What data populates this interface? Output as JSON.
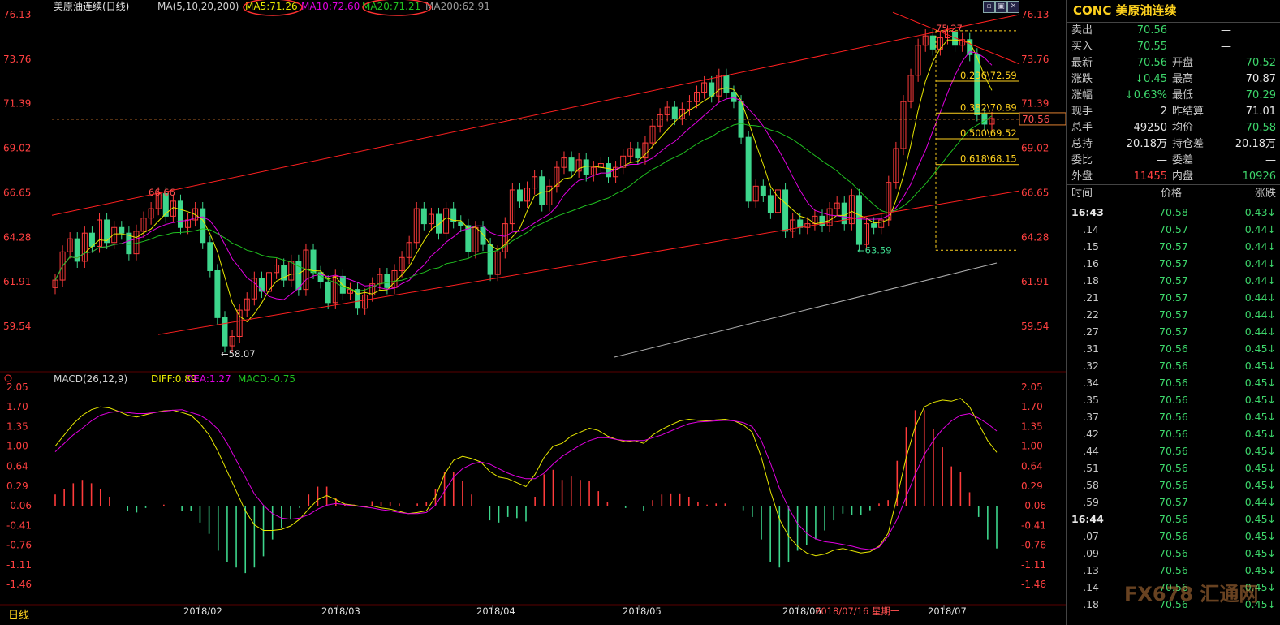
{
  "header": {
    "title": "美原油连续(日线)",
    "ma_label": "MA(5,10,20,200)",
    "ma5": "MA5:71.26",
    "ma10": "MA10:72.60",
    "ma20": "MA20:71.21",
    "ma200": "MA200:62.91"
  },
  "macd_header": {
    "label": "MACD(26,12,9)",
    "diff": "DIFF:0.89",
    "dea": "DEA:1.27",
    "macd": "MACD:-0.75"
  },
  "colors": {
    "up": "#ff3b3b",
    "down": "#3dd68c",
    "ma5": "#e8e800",
    "ma10": "#e000e0",
    "ma20": "#20c020",
    "ma200": "#b0b0b0",
    "trend": "#ff2020",
    "fib": "#ffd21e"
  },
  "chart_data": {
    "type": "candlestick",
    "price_ticks": [
      "76.13",
      "73.76",
      "71.39",
      "69.02",
      "66.65",
      "64.28",
      "61.91",
      "59.54"
    ],
    "macd_ticks": [
      "2.05",
      "1.70",
      "1.35",
      "1.00",
      "0.64",
      "0.29",
      "-0.06",
      "-0.41",
      "-0.76",
      "-1.11",
      "-1.46"
    ],
    "x_labels": [
      "2018/02",
      "2018/03",
      "2018/04",
      "2018/05",
      "2018/06",
      "2018/07"
    ],
    "cursor_label": "2018/07/16 星期一",
    "period_button": "日线",
    "last_price_tag": "70.56",
    "annotations": {
      "high": "75.27",
      "low_left": "58.07",
      "left_peak": "66.66",
      "low_right": "63.59"
    },
    "fibonacci": [
      {
        "ratio": "0.236",
        "price": "72.59"
      },
      {
        "ratio": "0.382",
        "price": "70.89"
      },
      {
        "ratio": "0.500",
        "price": "69.52"
      },
      {
        "ratio": "0.618",
        "price": "68.15"
      }
    ],
    "close": [
      62.0,
      63.5,
      64.2,
      63.0,
      64.5,
      63.8,
      65.2,
      64.0,
      64.8,
      64.5,
      63.4,
      64.6,
      65.3,
      65.8,
      66.6,
      65.4,
      66.2,
      64.8,
      65.2,
      65.8,
      64.0,
      62.5,
      60.0,
      58.5,
      59.0,
      60.4,
      61.0,
      62.1,
      61.4,
      62.4,
      62.8,
      62.0,
      63.0,
      61.5,
      63.6,
      62.4,
      61.9,
      60.8,
      62.2,
      61.3,
      61.5,
      60.5,
      61.2,
      61.8,
      62.3,
      61.6,
      62.5,
      63.2,
      64.0,
      65.8,
      65.0,
      65.5,
      64.5,
      65.8,
      65.1,
      64.9,
      63.5,
      64.8,
      63.9,
      62.3,
      63.5,
      65.0,
      66.8,
      66.2,
      66.9,
      67.5,
      66.0,
      67.0,
      68.0,
      68.5,
      67.8,
      68.4,
      67.6,
      68.0,
      68.2,
      67.5,
      68.0,
      68.6,
      69.0,
      68.5,
      69.3,
      70.2,
      70.8,
      71.2,
      70.6,
      71.1,
      71.5,
      72.0,
      72.5,
      71.8,
      72.9,
      72.0,
      71.5,
      69.6,
      66.2,
      67.0,
      66.5,
      65.6,
      66.8,
      64.6,
      65.2,
      64.8,
      65.0,
      65.4,
      64.9,
      65.8,
      66.1,
      65.0,
      66.5,
      63.9,
      65.0,
      64.8,
      65.2,
      67.2,
      69.0,
      71.5,
      72.9,
      74.5,
      75.0,
      74.3,
      74.9,
      75.2,
      74.5,
      74.8,
      74.0,
      70.8,
      70.3,
      70.6
    ],
    "ma200_end": [
      60.1,
      62.91
    ],
    "macd_series_desc": "DIFF/DEA/histogram drawn from values",
    "diff": [
      1.0,
      1.2,
      1.4,
      1.55,
      1.65,
      1.7,
      1.68,
      1.62,
      1.55,
      1.52,
      1.56,
      1.6,
      1.63,
      1.64,
      1.6,
      1.55,
      1.4,
      1.2,
      0.9,
      0.55,
      0.2,
      -0.15,
      -0.4,
      -0.5,
      -0.5,
      -0.48,
      -0.42,
      -0.3,
      -0.12,
      0.05,
      0.12,
      0.05,
      -0.03,
      -0.05,
      -0.08,
      -0.06,
      -0.1,
      -0.12,
      -0.16,
      -0.2,
      -0.18,
      -0.15,
      0.1,
      0.5,
      0.75,
      0.82,
      0.78,
      0.72,
      0.55,
      0.45,
      0.42,
      0.35,
      0.28,
      0.5,
      0.8,
      1.0,
      1.05,
      1.18,
      1.25,
      1.32,
      1.28,
      1.18,
      1.12,
      1.08,
      1.1,
      1.05,
      1.2,
      1.3,
      1.38,
      1.45,
      1.48,
      1.46,
      1.45,
      1.47,
      1.48,
      1.45,
      1.38,
      1.25,
      0.8,
      0.2,
      -0.3,
      -0.6,
      -0.78,
      -0.9,
      -0.95,
      -0.92,
      -0.85,
      -0.82,
      -0.86,
      -0.9,
      -0.88,
      -0.78,
      -0.55,
      0.1,
      0.8,
      1.35,
      1.7,
      1.78,
      1.82,
      1.8,
      1.85,
      1.7,
      1.4,
      1.1,
      0.89
    ],
    "dea": [
      0.9,
      1.05,
      1.2,
      1.32,
      1.45,
      1.55,
      1.6,
      1.62,
      1.6,
      1.58,
      1.58,
      1.6,
      1.62,
      1.64,
      1.65,
      1.6,
      1.55,
      1.45,
      1.3,
      1.05,
      0.75,
      0.45,
      0.15,
      -0.05,
      -0.2,
      -0.28,
      -0.3,
      -0.28,
      -0.22,
      -0.12,
      -0.05,
      -0.02,
      -0.04,
      -0.06,
      -0.08,
      -0.1,
      -0.13,
      -0.15,
      -0.18,
      -0.2,
      -0.2,
      -0.18,
      -0.05,
      0.2,
      0.45,
      0.6,
      0.68,
      0.72,
      0.68,
      0.6,
      0.52,
      0.46,
      0.42,
      0.42,
      0.52,
      0.68,
      0.82,
      0.92,
      1.02,
      1.1,
      1.15,
      1.15,
      1.12,
      1.1,
      1.1,
      1.1,
      1.15,
      1.2,
      1.27,
      1.34,
      1.4,
      1.43,
      1.44,
      1.45,
      1.46,
      1.45,
      1.42,
      1.35,
      1.1,
      0.7,
      0.25,
      -0.1,
      -0.38,
      -0.55,
      -0.65,
      -0.7,
      -0.72,
      -0.75,
      -0.78,
      -0.82,
      -0.84,
      -0.8,
      -0.6,
      -0.3,
      0.1,
      0.5,
      0.85,
      1.1,
      1.3,
      1.45,
      1.55,
      1.58,
      1.5,
      1.4,
      1.27
    ]
  },
  "quote_panel": {
    "title": "CONC 美原油连续",
    "rows": [
      {
        "l": "卖出",
        "v": "70.56",
        "v2": "—",
        "l2": "",
        "r": ""
      },
      {
        "l": "买入",
        "v": "70.55",
        "v2": "—",
        "l2": "",
        "r": ""
      },
      {
        "l": "最新",
        "v": "70.56",
        "l2": "开盘",
        "r": "70.52"
      },
      {
        "l": "涨跌",
        "v": "↓0.45",
        "l2": "最高",
        "r": "70.87"
      },
      {
        "l": "涨幅",
        "v": "↓0.63%",
        "l2": "最低",
        "r": "70.29"
      },
      {
        "l": "现手",
        "v": "2",
        "l2": "昨结算",
        "r": "71.01"
      },
      {
        "l": "总手",
        "v": "49250",
        "l2": "均价",
        "r": "70.58"
      },
      {
        "l": "总持",
        "v": "20.18万",
        "l2": "持仓差",
        "r": "20.18万"
      },
      {
        "l": "委比",
        "v": "—",
        "l2": "委差",
        "r": "—"
      },
      {
        "l": "外盘",
        "v": "11455",
        "l2": "内盘",
        "r": "10926"
      }
    ],
    "tick_header": {
      "time": "时间",
      "price": "价格",
      "change": "涨跌"
    },
    "ticks": [
      {
        "t": "16:43",
        "p": "70.58",
        "c": "0.43"
      },
      {
        "t": ".14",
        "p": "70.57",
        "c": "0.44"
      },
      {
        "t": ".15",
        "p": "70.57",
        "c": "0.44"
      },
      {
        "t": ".16",
        "p": "70.57",
        "c": "0.44"
      },
      {
        "t": ".18",
        "p": "70.57",
        "c": "0.44"
      },
      {
        "t": ".21",
        "p": "70.57",
        "c": "0.44"
      },
      {
        "t": ".22",
        "p": "70.57",
        "c": "0.44"
      },
      {
        "t": ".27",
        "p": "70.57",
        "c": "0.44"
      },
      {
        "t": ".31",
        "p": "70.56",
        "c": "0.45"
      },
      {
        "t": ".32",
        "p": "70.56",
        "c": "0.45"
      },
      {
        "t": ".34",
        "p": "70.56",
        "c": "0.45"
      },
      {
        "t": ".35",
        "p": "70.56",
        "c": "0.45"
      },
      {
        "t": ".37",
        "p": "70.56",
        "c": "0.45"
      },
      {
        "t": ".42",
        "p": "70.56",
        "c": "0.45"
      },
      {
        "t": ".44",
        "p": "70.56",
        "c": "0.45"
      },
      {
        "t": ".51",
        "p": "70.56",
        "c": "0.45"
      },
      {
        "t": ".58",
        "p": "70.56",
        "c": "0.45"
      },
      {
        "t": ".59",
        "p": "70.57",
        "c": "0.44"
      },
      {
        "t": "16:44",
        "p": "70.56",
        "c": "0.45"
      },
      {
        "t": ".07",
        "p": "70.56",
        "c": "0.45"
      },
      {
        "t": ".09",
        "p": "70.56",
        "c": "0.45"
      },
      {
        "t": ".13",
        "p": "70.56",
        "c": "0.45"
      },
      {
        "t": ".14",
        "p": "70.56",
        "c": "0.45"
      },
      {
        "t": ".18",
        "p": "70.56",
        "c": "0.45"
      }
    ],
    "watermark": "FX678 汇通网"
  }
}
